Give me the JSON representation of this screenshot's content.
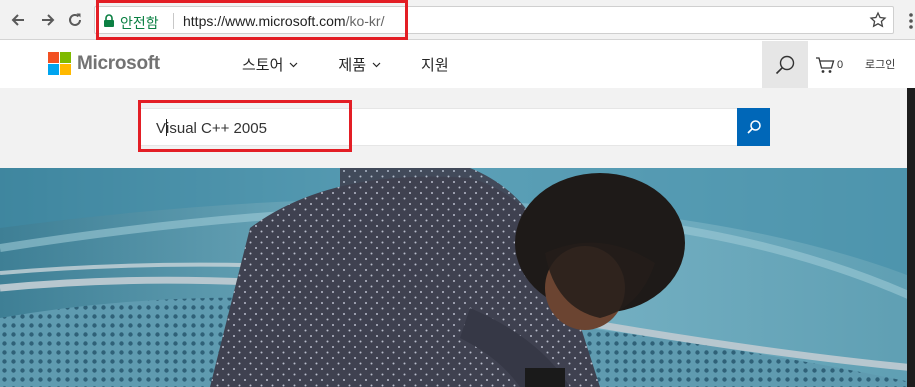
{
  "browser": {
    "secure_label": "안전함",
    "url_host": "https://www.microsoft.com",
    "url_path": "/ko-kr/",
    "icons": [
      "back-arrow-icon",
      "forward-arrow-icon",
      "reload-icon",
      "lock-icon",
      "bookmark-star-icon",
      "menu-icon"
    ],
    "secure_color": "#0b8043"
  },
  "site": {
    "brand": "Microsoft",
    "brand_colors": [
      "#f25022",
      "#7fba00",
      "#00a4ef",
      "#ffb900"
    ],
    "nav": [
      {
        "label": "스토어",
        "has_dropdown": true
      },
      {
        "label": "제품",
        "has_dropdown": true
      },
      {
        "label": "지원",
        "has_dropdown": false
      }
    ],
    "cart_count": "0",
    "signin_label": "로그인",
    "accent": "#0067b8"
  },
  "search": {
    "value": "Visual C++ 2005",
    "value_before_caret": "V",
    "value_after_caret": "isual C++ 2005"
  },
  "annotations": {
    "highlight_color": "#e31e25",
    "highlighted": [
      "address-bar",
      "search-input"
    ]
  }
}
